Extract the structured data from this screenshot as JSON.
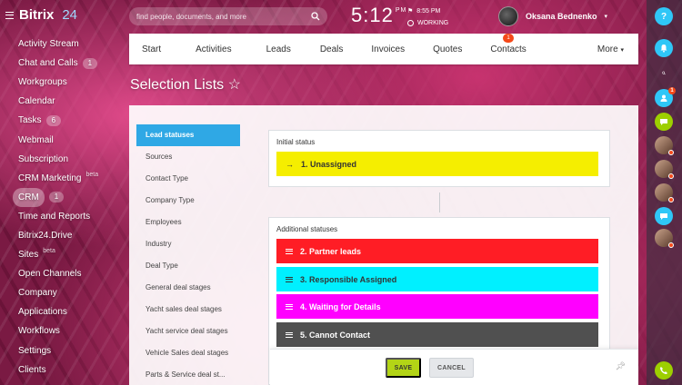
{
  "app": {
    "name": "Bitrix",
    "version": "24"
  },
  "sidebar": {
    "items": [
      {
        "label": "Activity Stream"
      },
      {
        "label": "Chat and Calls",
        "count": "1"
      },
      {
        "label": "Workgroups"
      },
      {
        "label": "Calendar"
      },
      {
        "label": "Tasks",
        "count": "6"
      },
      {
        "label": "Webmail"
      },
      {
        "label": "Subscription"
      },
      {
        "label": "CRM Marketing",
        "beta": "beta"
      },
      {
        "label": "CRM",
        "count": "1"
      },
      {
        "label": "Time and Reports"
      },
      {
        "label": "Bitrix24.Drive"
      },
      {
        "label": "Sites",
        "beta": "beta"
      },
      {
        "label": "Open Channels"
      },
      {
        "label": "Company"
      },
      {
        "label": "Applications"
      },
      {
        "label": "Workflows"
      },
      {
        "label": "Settings"
      },
      {
        "label": "Clients"
      }
    ]
  },
  "header": {
    "search_placeholder": "find people, documents, and more",
    "time": "5:12",
    "ampm": "PM",
    "work_time": "8:55 PM",
    "work_status": "WORKING",
    "user_name": "Oksana Bednenko"
  },
  "nav": {
    "tabs": [
      "Start",
      "Activities",
      "Leads",
      "Deals",
      "Invoices",
      "Quotes",
      "Contacts"
    ],
    "contacts_badge": "1",
    "more": "More"
  },
  "right_bar": {
    "help": "?",
    "notify_badge": "1"
  },
  "page": {
    "title": "Selection Lists",
    "star": "☆"
  },
  "lists": [
    "Lead statuses",
    "Sources",
    "Contact Type",
    "Company Type",
    "Employees",
    "Industry",
    "Deal Type",
    "General deal stages",
    "Yacht sales deal stages",
    "Yacht service deal stages",
    "Vehicle Sales deal stages",
    "Parts & Service deal st..."
  ],
  "initial": {
    "header": "Initial status",
    "arrow": "→",
    "status": {
      "label": "1. Unassigned",
      "color": "#f5ee00"
    }
  },
  "additional": {
    "header": "Additional statuses",
    "statuses": [
      {
        "label": "2. Partner leads",
        "color": "#ff1d25",
        "text_color": "#ffffff"
      },
      {
        "label": "3. Responsible Assigned",
        "color": "#00f0ff",
        "text_color": "#333333"
      },
      {
        "label": "4. Waiting for Details",
        "color": "#ff00ff",
        "text_color": "#ffffff"
      },
      {
        "label": "5. Cannot Contact",
        "color": "#505050",
        "text_color": "#ffffff"
      }
    ]
  },
  "footer": {
    "save": "SAVE",
    "cancel": "CANCEL"
  }
}
